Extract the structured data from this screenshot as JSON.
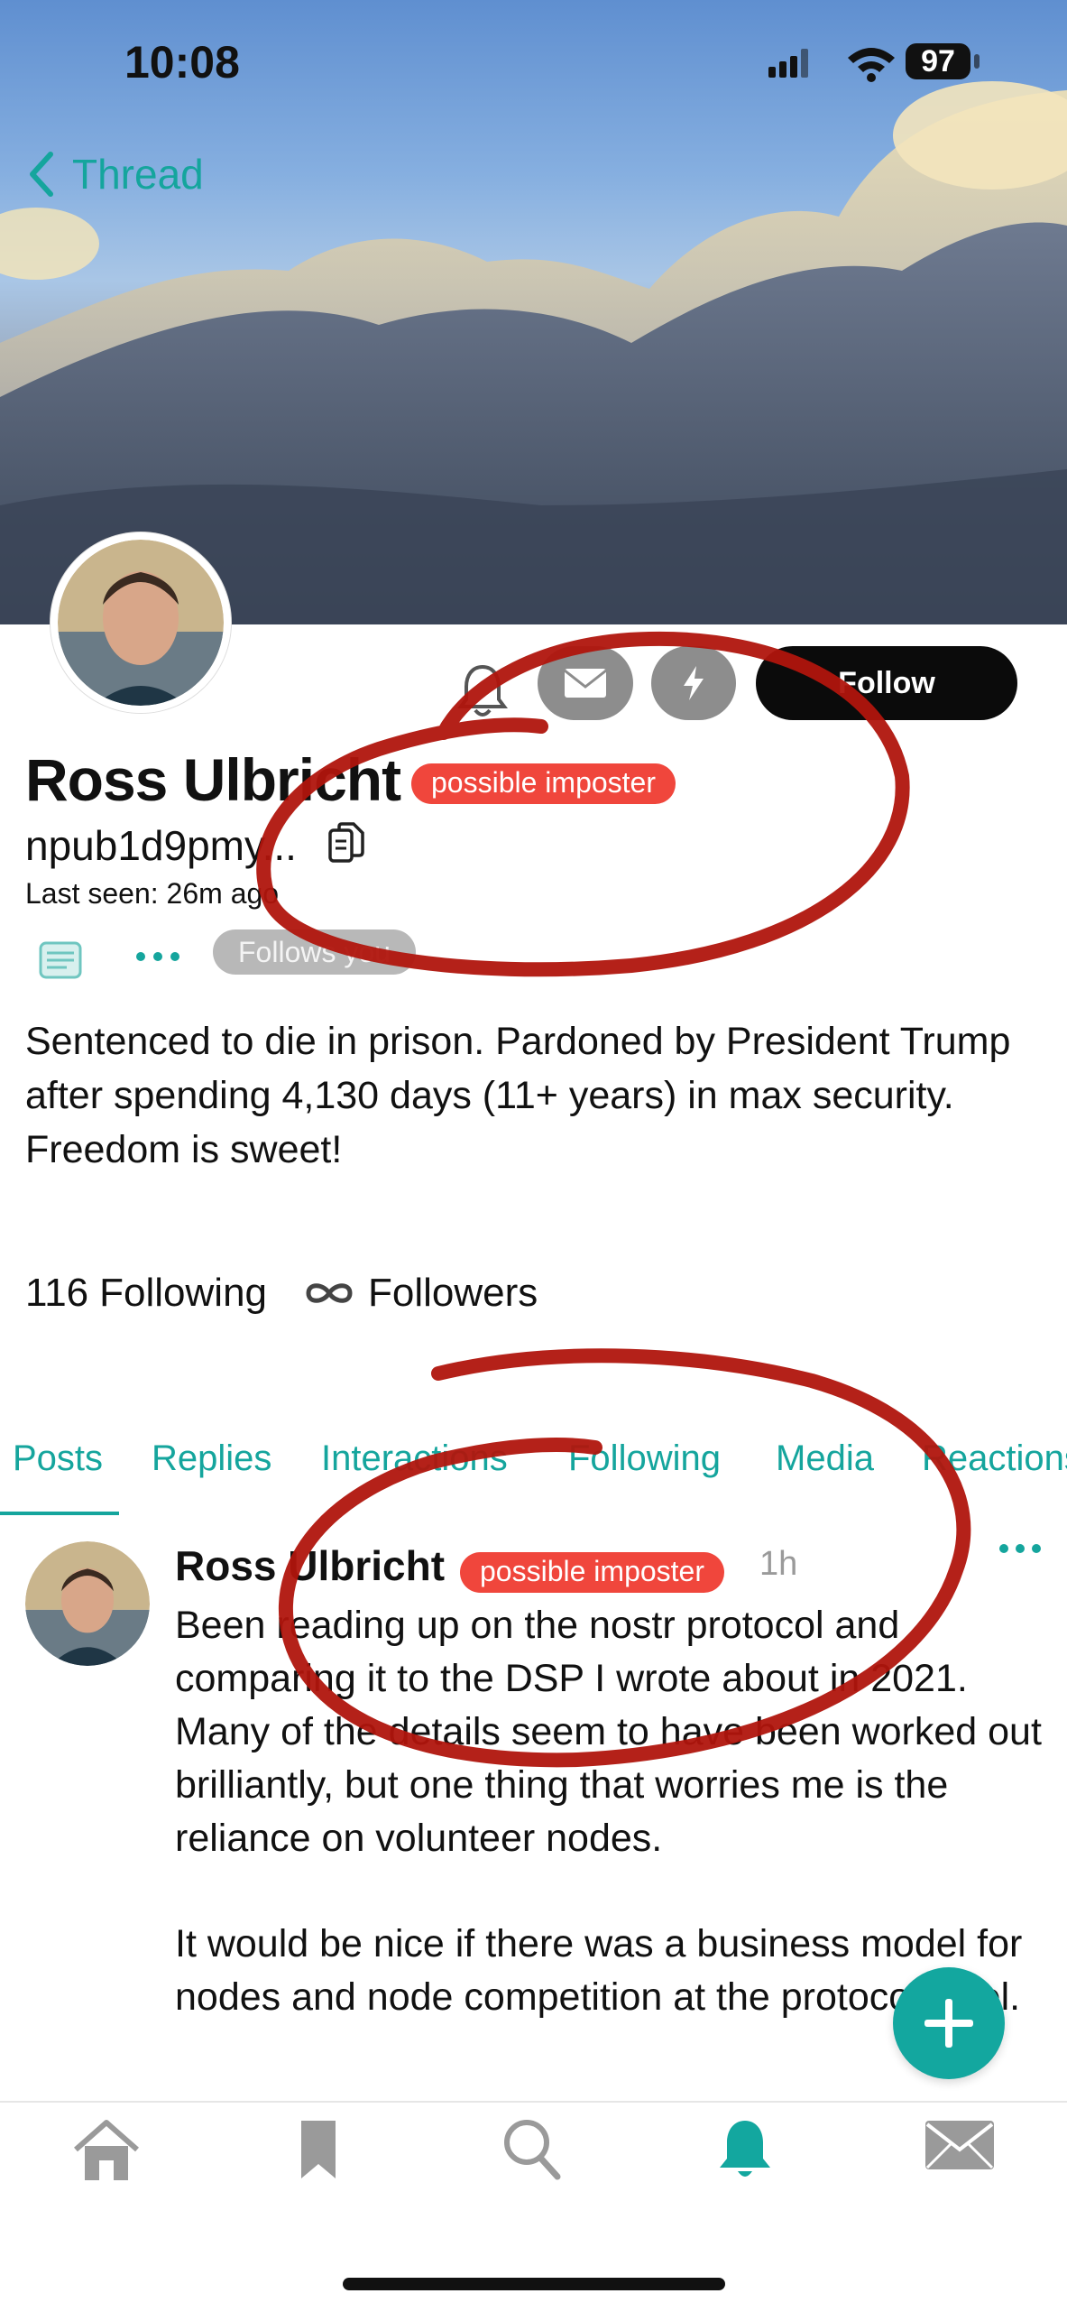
{
  "status_bar": {
    "time": "10:08",
    "battery": "97"
  },
  "nav": {
    "back_label": "Thread"
  },
  "profile": {
    "name": "Ross Ulbricht",
    "badge": "possible imposter",
    "npub": "npub1d9pmy...",
    "last_seen": "Last seen: 26m ago",
    "follows_you": "Follows you",
    "follow_button": "Follow",
    "bio": "Sentenced to die in prison. Pardoned by President Trump after spending 4,130 days (11+ years) in max security. Freedom is sweet!",
    "following_count": "116",
    "following_label": "Following",
    "followers_label": "Followers"
  },
  "tabs": [
    "Posts",
    "Replies",
    "Interactions",
    "Following",
    "Media",
    "Reactions"
  ],
  "active_tab": "Posts",
  "post": {
    "author": "Ross Ulbricht",
    "badge": "possible imposter",
    "time": "1h",
    "paragraphs": [
      "Been reading up on the nostr protocol and comparing it to the DSP I wrote about in 2021. Many of the details seem to have been worked out brilliantly, but one thing that worries me is the reliance on volunteer nodes.",
      "It would be nice if there was a business model for nodes and node competition at the protocol level."
    ]
  },
  "bottom_nav": [
    "home-icon",
    "bookmark-icon",
    "search-icon",
    "notifications-icon",
    "messages-icon"
  ],
  "colors": {
    "accent": "#15a59d",
    "badge": "#f0463c",
    "annotation": "#b0150d",
    "follow_bg": "#0b0b0b"
  }
}
